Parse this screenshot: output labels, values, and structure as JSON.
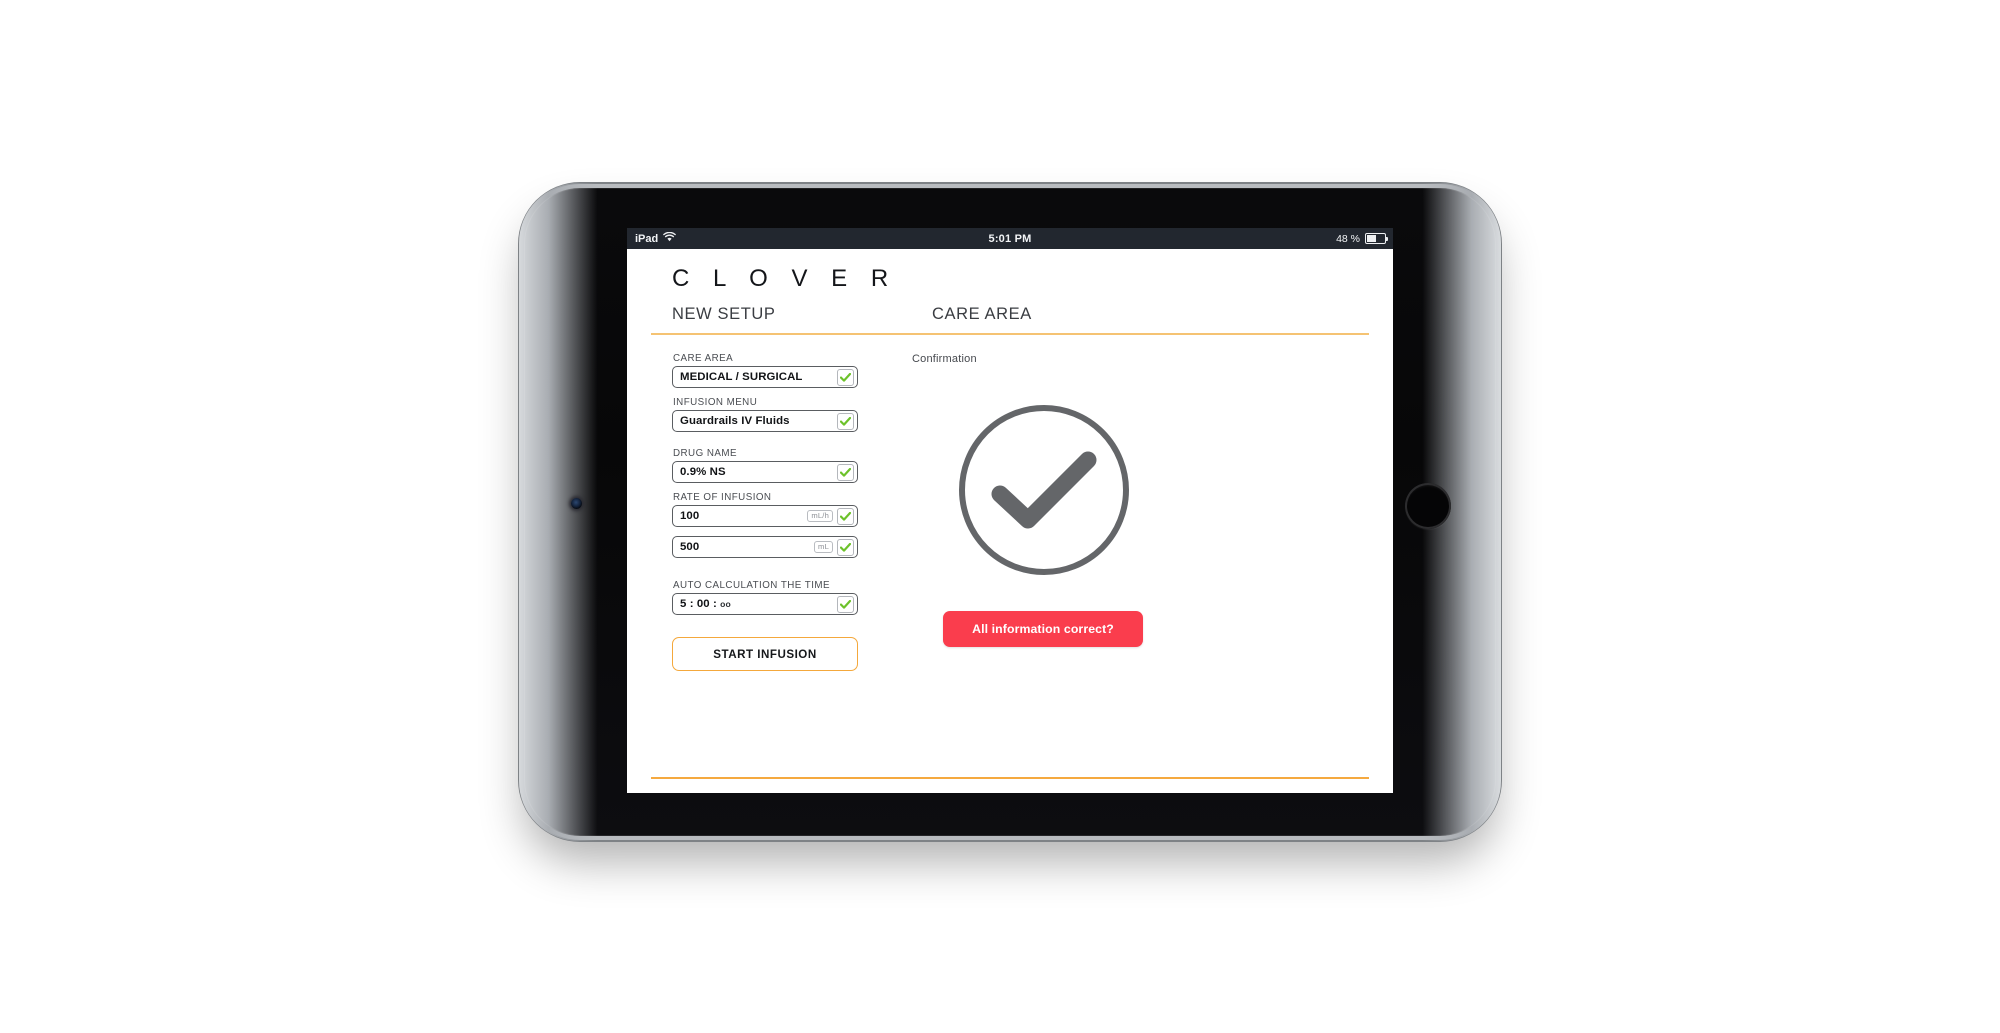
{
  "status_bar": {
    "carrier": "iPad",
    "wifi_icon": "wifi-icon",
    "time": "5:01 PM",
    "battery_text": "48 %",
    "battery_icon": "battery-half-icon"
  },
  "app": {
    "logo": "C L O V E R",
    "headers": {
      "left": "NEW SETUP",
      "right": "CARE AREA"
    },
    "form": {
      "fields": [
        {
          "label": "CARE AREA",
          "value": "MEDICAL / SURGICAL",
          "unit": "",
          "checked": true
        },
        {
          "label": "INFUSION MENU",
          "value": "Guardrails IV Fluids",
          "unit": "",
          "checked": true
        },
        {
          "label": "DRUG NAME",
          "value": "0.9% NS",
          "unit": "",
          "checked": true
        },
        {
          "label": "RATE OF INFUSION",
          "value": "100",
          "unit": "mL/h",
          "checked": true
        },
        {
          "label": "",
          "value": "500",
          "unit": "mL",
          "checked": true
        },
        {
          "label": "AUTO CALCULATION THE TIME",
          "value": "5 : 00 : ",
          "value_small": "oo",
          "unit": "",
          "checked": true
        }
      ],
      "start_button": "START INFUSION"
    },
    "confirmation": {
      "label": "Confirmation",
      "check_icon": "check-circle-icon",
      "button": "All information correct?"
    }
  },
  "colors": {
    "accent_orange": "#F5A93F",
    "header_rule": "#F5C373",
    "alert_red": "#FA3D4D",
    "check_green": "#6DC22B",
    "confirm_gray": "#646669",
    "statusbar_bg": "#22272F"
  }
}
